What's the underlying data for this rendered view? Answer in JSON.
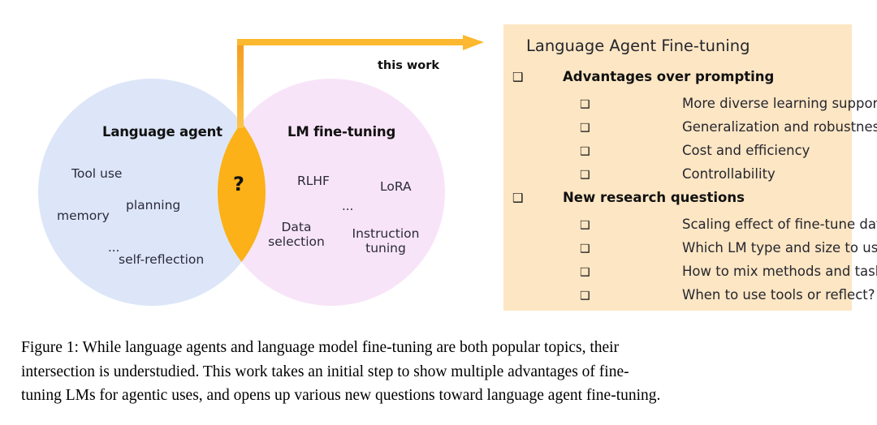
{
  "venn": {
    "left_circle": {
      "title": "Language agent",
      "color": "#dce6f8",
      "terms": [
        "Tool use",
        "planning",
        "memory",
        "...",
        "self-reflection"
      ]
    },
    "right_circle": {
      "title": "LM fine-tuning",
      "color": "#f8e4f8",
      "terms": [
        "RLHF",
        "LoRA",
        "...",
        "Data\nselection",
        "Instruction\ntuning"
      ]
    },
    "intersection": {
      "label": "?",
      "color": "#fbb117"
    },
    "terms_text": {
      "tool_use": "Tool use",
      "planning": "planning",
      "memory": "memory",
      "dots_left": "...",
      "self_reflection": "self-reflection",
      "rlhf": "RLHF",
      "lora": "LoRA",
      "dots_right": "...",
      "data_selection_line1": "Data",
      "data_selection_line2": "selection",
      "instruction_line1": "Instruction",
      "instruction_line2": "tuning"
    }
  },
  "arrow": {
    "label": "this work",
    "color": "#fbb117",
    "icon": "right-arrow-icon"
  },
  "panel": {
    "background": "#fce6c4",
    "title": "Language Agent Fine-tuning",
    "bullet_glyph": "❑",
    "rows": [
      {
        "level": 1,
        "text": "Advantages over prompting"
      },
      {
        "level": 2,
        "text": "More diverse learning support"
      },
      {
        "level": 2,
        "text": "Generalization and robustness"
      },
      {
        "level": 2,
        "text": "Cost and efficiency"
      },
      {
        "level": 2,
        "text": "Controllability"
      },
      {
        "level": 1,
        "text": "New research questions"
      },
      {
        "level": 2,
        "text": "Scaling effect of fine-tune data?"
      },
      {
        "level": 2,
        "text": "Which LM type and size to use?"
      },
      {
        "level": 2,
        "text": "How to mix methods and tasks?"
      },
      {
        "level": 2,
        "text": "When to use tools or reflect?"
      }
    ]
  },
  "caption": {
    "line1": "Figure 1:  While language agents and language model fine-tuning are both popular topics, their",
    "line2": "intersection is understudied.  This work takes an initial step to show multiple advantages of fine-",
    "line3": "tuning LMs for agentic uses, and opens up various new questions toward language agent fine-tuning."
  }
}
